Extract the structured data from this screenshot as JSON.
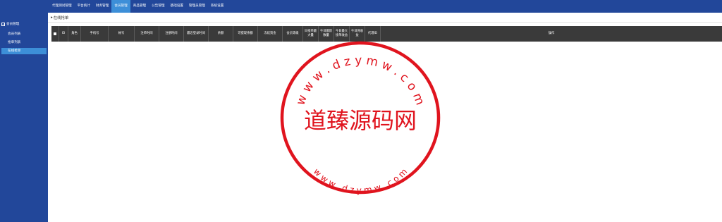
{
  "top_nav": [
    "代理测试管理",
    "平台统计",
    "财务管理",
    "会员管理",
    "商品管理",
    "公告管理",
    "基础设置",
    "管理员管理",
    "系统设置"
  ],
  "sidebar": {
    "group": "会员管理",
    "items": [
      "会员列表",
      "抢单列表",
      "在线抢单"
    ]
  },
  "breadcrumb": "在线抢单",
  "table": {
    "columns": [
      "",
      "ID",
      "角色",
      "手机号",
      "帐号",
      "注单时间",
      "注册时间",
      "最近登录时间",
      "余额",
      "可提现余额",
      "冻结资金",
      "会员等级",
      "日接单最大量",
      "今日最新数量",
      "今日最大接单收益",
      "今日佣收益",
      "代理ID",
      "操作"
    ]
  },
  "watermark": {
    "brand": "道臻源码网",
    "url_top": "w w w . d z y m w . c o m",
    "url_bottom": "w w w . d z y m w . c o m"
  },
  "colors": {
    "nav_bg": "#22479a",
    "nav_active": "#3d8fd8",
    "table_header": "#3a3a3a",
    "stamp": "#e0141e"
  }
}
